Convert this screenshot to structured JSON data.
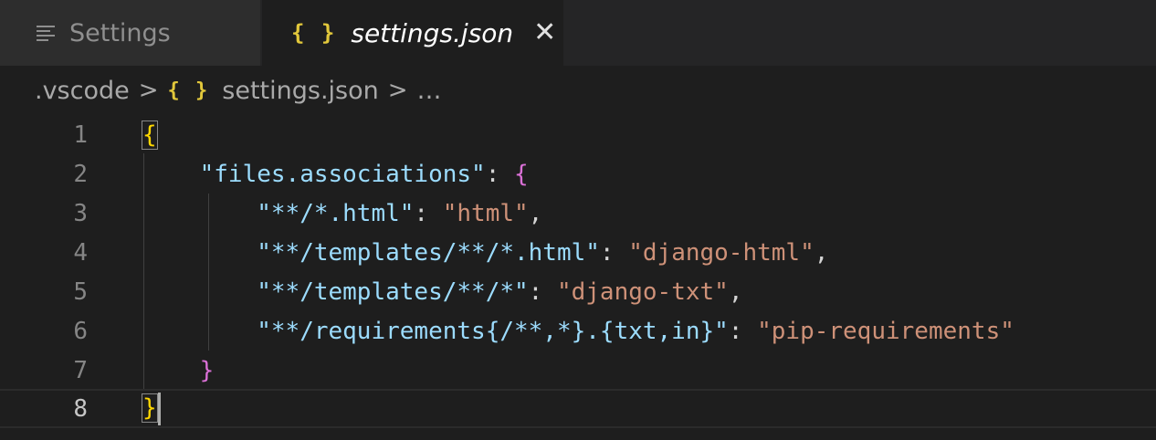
{
  "tabs": [
    {
      "label": "Settings",
      "icon": "menu-lines-icon",
      "active": false
    },
    {
      "label": "settings.json",
      "icon": "json-braces-icon",
      "active": true
    }
  ],
  "tab_icon_glyph": "{ }",
  "close_glyph": "✕",
  "breadcrumb": {
    "folder": ".vscode",
    "separator": ">",
    "file": "settings.json",
    "ellipsis": "…"
  },
  "editor": {
    "line_numbers": [
      "1",
      "2",
      "3",
      "4",
      "5",
      "6",
      "7",
      "8"
    ],
    "active_line": "8",
    "lines": {
      "l1_open": "{",
      "l2_key": "\"files.associations\"",
      "l2_colon": ": ",
      "l2_open": "{",
      "l3_key": "\"**/*.html\"",
      "l3_colon": ": ",
      "l3_val": "\"html\"",
      "l3_comma": ",",
      "l4_key": "\"**/templates/**/*.html\"",
      "l4_colon": ": ",
      "l4_val": "\"django-html\"",
      "l4_comma": ",",
      "l5_key": "\"**/templates/**/*\"",
      "l5_colon": ": ",
      "l5_val": "\"django-txt\"",
      "l5_comma": ",",
      "l6_key": "\"**/requirements{/**,*}.{txt,in}\"",
      "l6_colon": ": ",
      "l6_val": "\"pip-requirements\"",
      "l7_close": "}",
      "l8_close": "}"
    }
  },
  "colors": {
    "key": "#9cdcfe",
    "string": "#ce9178",
    "bracket_level1": "#ffd700",
    "bracket_level2": "#da70d6",
    "icon_yellow": "#e2c83b"
  }
}
